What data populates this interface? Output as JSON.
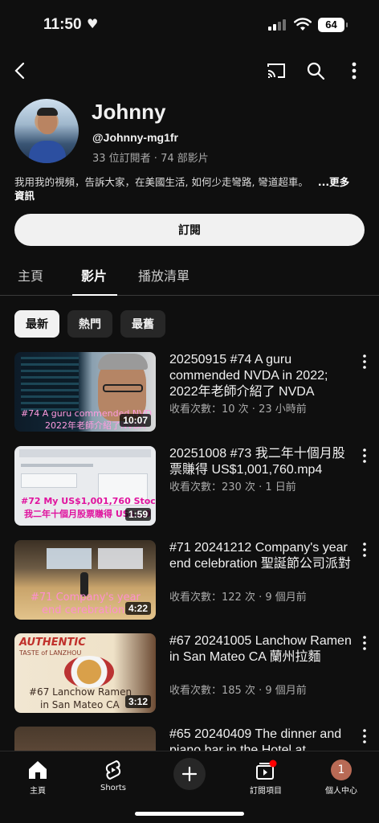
{
  "status_bar": {
    "time": "11:50",
    "battery": "64"
  },
  "channel": {
    "name": "Johnny",
    "handle": "@Johnny-mg1fr",
    "stats": "33 位訂閱者 · 74 部影片",
    "description": "我用我的視頻，告訴大家，在美國生活, 如何少走彎路, 彎道超車。",
    "more_label": "...更多",
    "more_label_2": "資訊",
    "subscribe_label": "訂閱"
  },
  "tabs": [
    {
      "label": "主頁"
    },
    {
      "label": "影片"
    },
    {
      "label": "播放清單"
    }
  ],
  "chips": [
    {
      "label": "最新"
    },
    {
      "label": "熱門"
    },
    {
      "label": "最舊"
    }
  ],
  "videos": [
    {
      "title": "20250915 #74 A guru commended NVDA in 2022; 2022年老師介紹了 NVDA",
      "meta": "收看次數：10 次 · 23 小時前",
      "duration": "10:07",
      "overlay_1": "#74 A guru commended NVD",
      "overlay_2": "2022年老師介紹了NVDA"
    },
    {
      "title": "20251008 #73 我二年十個月股票賺得 US$1,001,760.mp4",
      "meta": "收看次數：230 次 · 1 日前",
      "duration": "1:59",
      "overlay_1": "#72 My US$1,001,760 Stock",
      "overlay_2": "我二年十個月股票賺得 US$1,0"
    },
    {
      "title": "#71 20241212 Company's year end celebration 聖誕節公司派對",
      "meta": "收看次數：122 次 · 9 個月前",
      "duration": "4:22",
      "overlay_1": "#71 Company's year",
      "overlay_2": "end cerebration"
    },
    {
      "title": "#67 20241005 Lanchow Ramen in San Mateo CA  蘭州拉麵",
      "meta": "收看次數：185 次 · 9 個月前",
      "duration": "3:12",
      "overlay_1": "#67 Lanchow Ramen",
      "overlay_2": "in San Mateo CA",
      "sign_1": "AUTHENTIC",
      "sign_2": "TASTE of LANZHOU"
    },
    {
      "title": "#65  20240409 The dinner and piano bar in the Hotel at"
    }
  ],
  "bottom_nav": [
    {
      "label": "主頁",
      "icon": "home-icon"
    },
    {
      "label": "Shorts",
      "icon": "shorts-icon"
    },
    {
      "label": "",
      "icon": "create-icon"
    },
    {
      "label": "訂閱項目",
      "icon": "subscriptions-icon"
    },
    {
      "label": "個人中心",
      "icon": "account-avatar",
      "avatar_text": "1"
    }
  ],
  "colors": {
    "background": "#0f0f0f",
    "accent_red": "#ff0000",
    "avatar_badge": "#b86a55"
  }
}
